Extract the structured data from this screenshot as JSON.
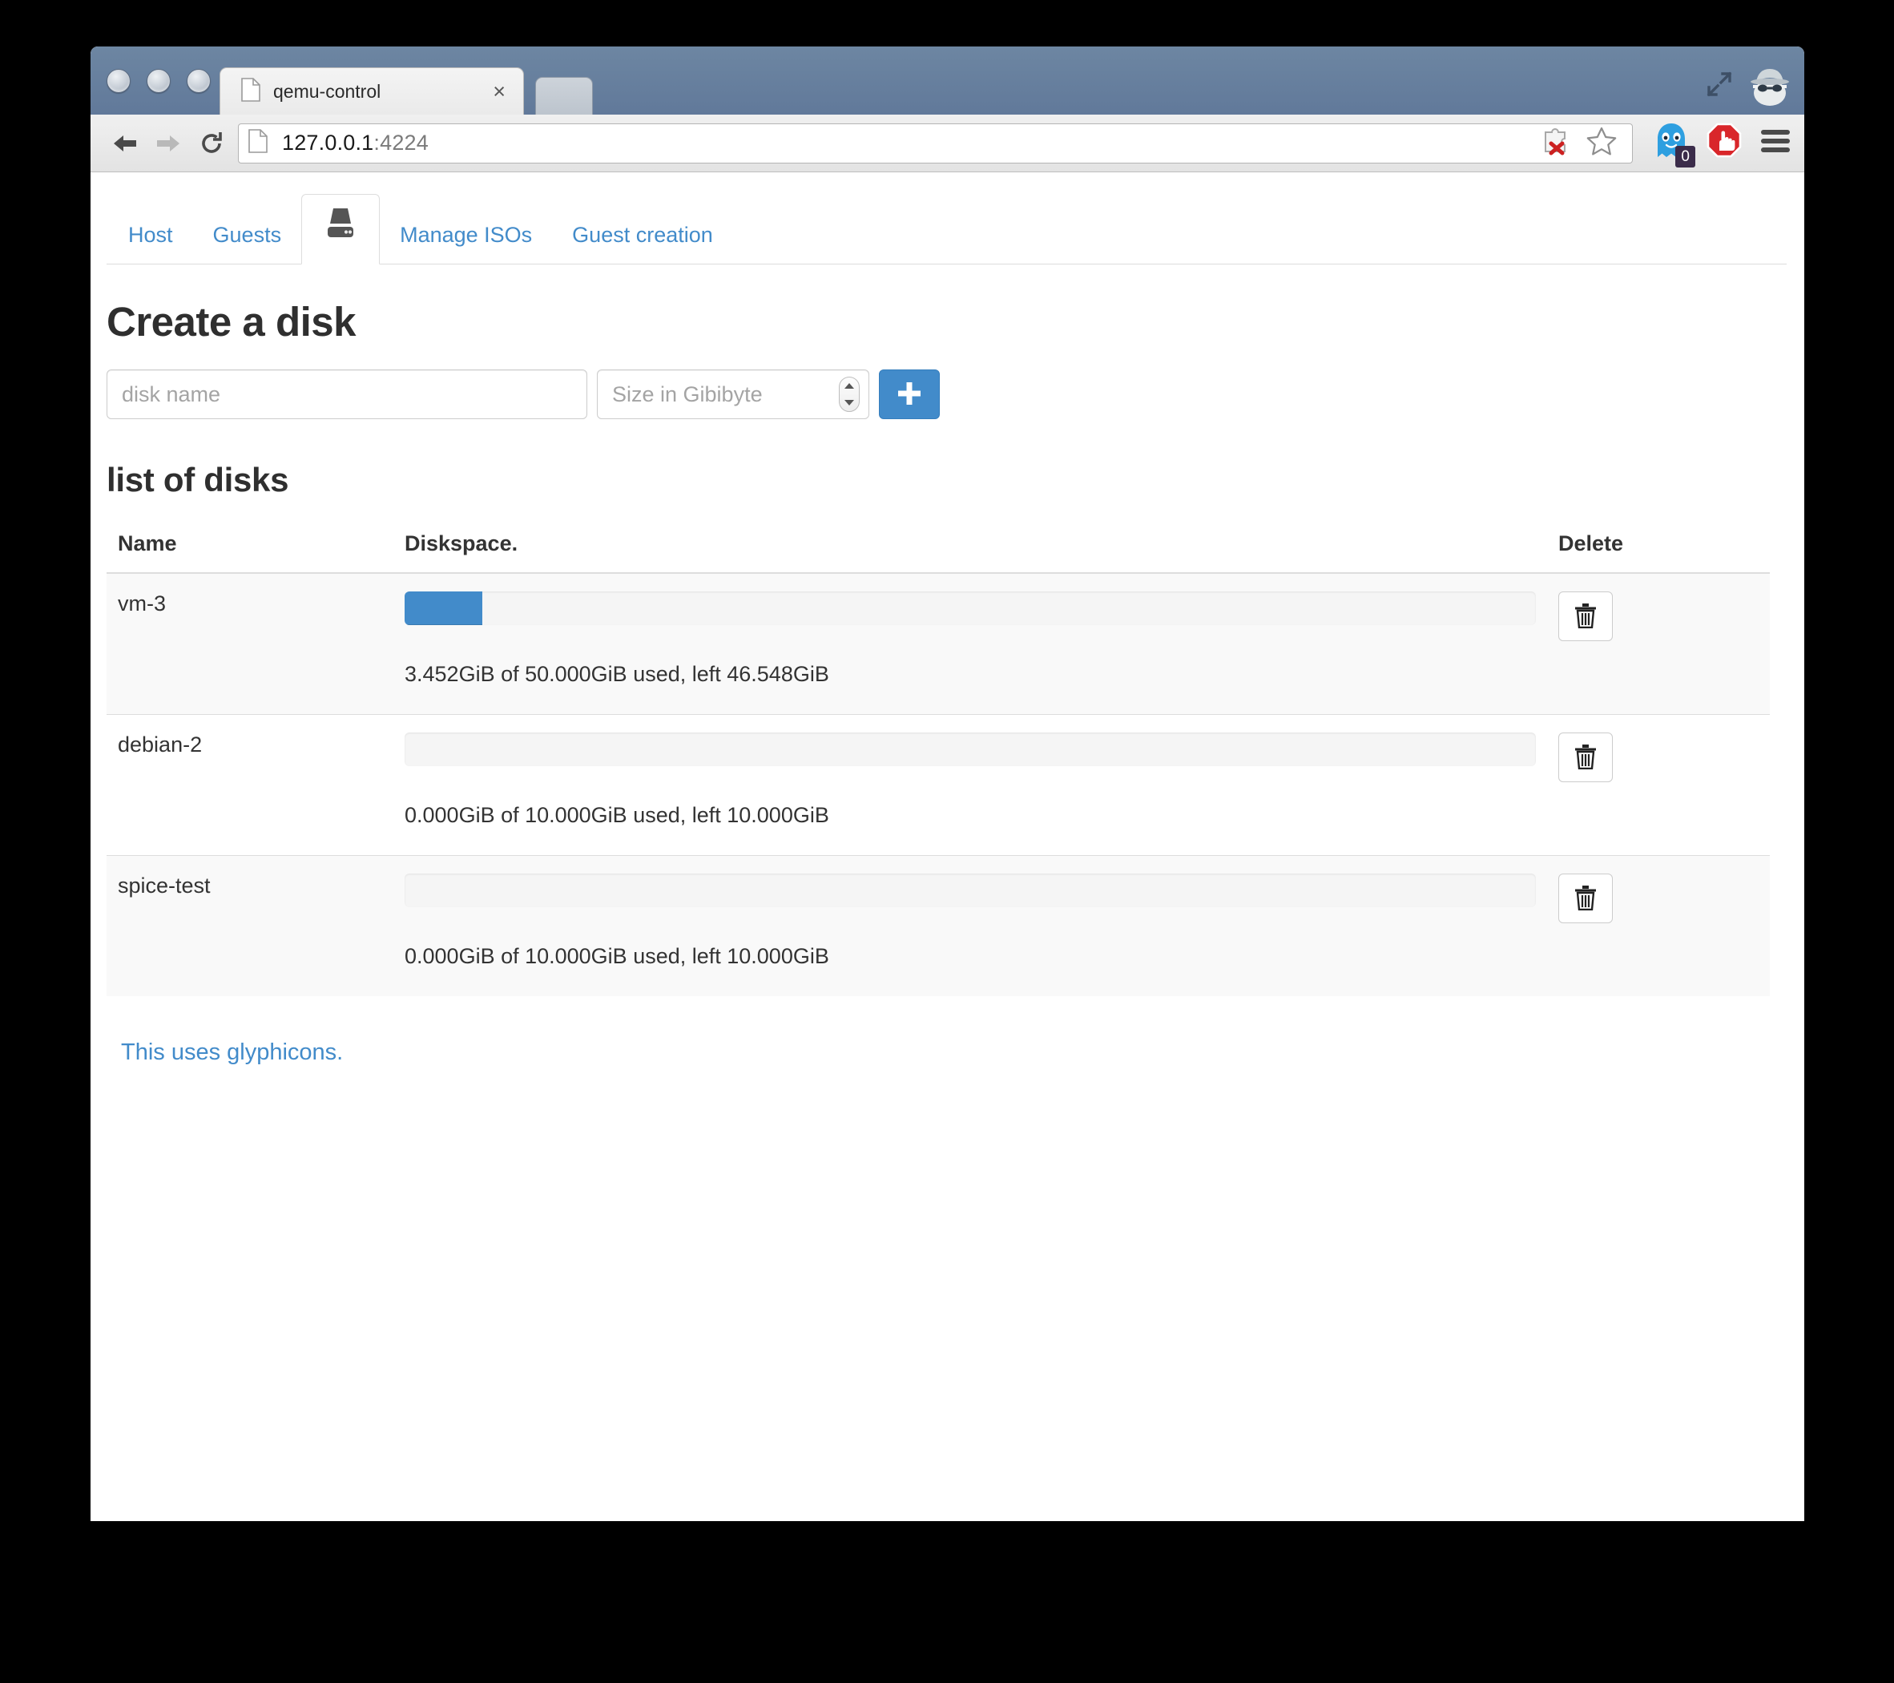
{
  "browser": {
    "tab": {
      "title": "qemu-control",
      "favicon": "document-icon",
      "close": "×"
    },
    "url": {
      "host": "127.0.0.1",
      "port": ":4224",
      "favicon": "document-icon"
    },
    "nav": {
      "back": "back-arrow-icon",
      "forward": "forward-arrow-icon",
      "reload": "reload-icon"
    },
    "toolbar_icons": [
      {
        "name": "extension-blocked-icon",
        "label": ""
      },
      {
        "name": "bookmark-star-icon",
        "label": ""
      },
      {
        "name": "ghostery-icon",
        "badge": "0"
      },
      {
        "name": "adblock-stop-icon",
        "label": ""
      },
      {
        "name": "chrome-menu-icon",
        "label": ""
      }
    ],
    "window_icons": [
      {
        "name": "fullscreen-expand-icon"
      },
      {
        "name": "incognito-icon"
      }
    ]
  },
  "tabs": [
    {
      "label": "Host",
      "active": false,
      "icon": null
    },
    {
      "label": "Guests",
      "active": false,
      "icon": null
    },
    {
      "label": "",
      "active": true,
      "icon": "hdd-icon"
    },
    {
      "label": "Manage ISOs",
      "active": false,
      "icon": null
    },
    {
      "label": "Guest creation",
      "active": false,
      "icon": null
    }
  ],
  "create": {
    "heading": "Create a disk",
    "name_placeholder": "disk name",
    "name_value": "",
    "size_placeholder": "Size in Gibibyte",
    "size_value": "",
    "submit_label": "+"
  },
  "disks": {
    "heading": "list of disks",
    "columns": [
      "Name",
      "Diskspace.",
      "Delete"
    ],
    "rows": [
      {
        "name": "vm-3",
        "used_gib": 3.452,
        "total_gib": 50.0,
        "left_gib": 46.548,
        "percent": 6.9,
        "usage_text": "3.452GiB of 50.000GiB used, left 46.548GiB",
        "delete_icon": "trash-icon"
      },
      {
        "name": "debian-2",
        "used_gib": 0.0,
        "total_gib": 10.0,
        "left_gib": 10.0,
        "percent": 0,
        "usage_text": "0.000GiB of 10.000GiB used, left 10.000GiB",
        "delete_icon": "trash-icon"
      },
      {
        "name": "spice-test",
        "used_gib": 0.0,
        "total_gib": 10.0,
        "left_gib": 10.0,
        "percent": 0,
        "usage_text": "0.000GiB of 10.000GiB used, left 10.000GiB",
        "delete_icon": "trash-icon"
      }
    ]
  },
  "footer": {
    "link_text": "This uses glyphicons."
  },
  "colors": {
    "primary": "#428bca",
    "link": "#428bca",
    "titlebar": "#61799a",
    "table_stripe": "#f9f9f9",
    "progress_track": "#f5f5f5"
  }
}
